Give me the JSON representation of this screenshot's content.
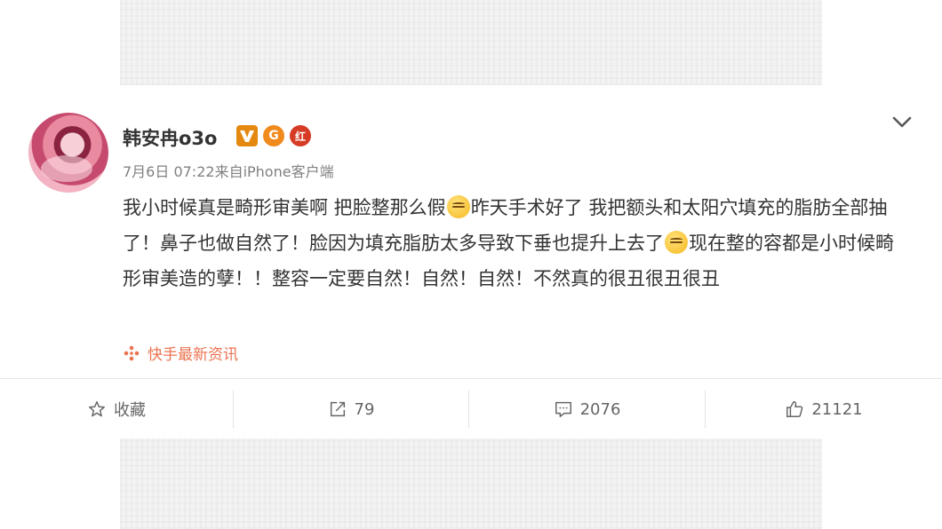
{
  "author": {
    "name": "韩安冉o3o",
    "badge_level": "G",
    "badge_red": "红"
  },
  "meta": {
    "timestamp": "7月6日 07:22",
    "source": "来自iPhone客户端"
  },
  "post": {
    "seg1": "我小时候真是畸形审美啊 把脸整那么假",
    "seg2": "昨天手术好了 我把额头和太阳穴填充的脂肪全部抽了！鼻子也做自然了！脸因为填充脂肪太多导致下垂也提升上去了",
    "seg3": "现在整的容都是小时候畸形审美造的孽！！整容一定要自然！自然！自然！不然真的很丑很丑很丑"
  },
  "source_link": {
    "label": "快手最新资讯"
  },
  "actions": {
    "favorite_label": "收藏",
    "repost_count": "79",
    "comment_count": "2076",
    "like_count": "21121"
  },
  "icons": {
    "verified": "verified-v-icon",
    "more": "chevron-down-icon",
    "favorite": "star-icon",
    "repost": "share-arrow-icon",
    "comment": "comment-icon",
    "like": "thumbs-up-icon"
  },
  "colors": {
    "link": "#eb7350",
    "badge_orange": "#e5880f",
    "badge_red": "#d63b26"
  }
}
